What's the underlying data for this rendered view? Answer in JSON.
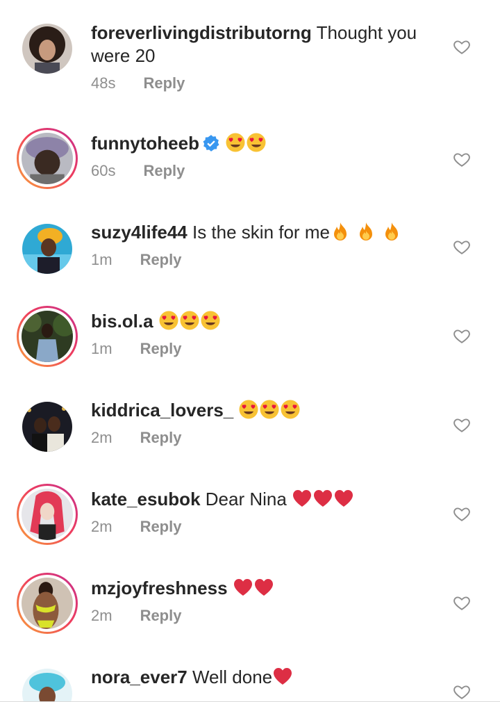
{
  "comments": [
    {
      "username": "foreverlivingdistributorng",
      "text": " Thought you were 20",
      "time": "48s",
      "reply_label": "Reply",
      "verified": false,
      "story_ring": false,
      "emojis": []
    },
    {
      "username": "funnytoheeb",
      "text": "",
      "time": "60s",
      "reply_label": "Reply",
      "verified": true,
      "story_ring": true,
      "emojis": [
        "heart-eyes",
        "heart-eyes"
      ]
    },
    {
      "username": "suzy4life44",
      "text": " Is the skin for me",
      "time": "1m",
      "reply_label": "Reply",
      "verified": false,
      "story_ring": false,
      "emojis": [
        "fire",
        "fire",
        "fire"
      ]
    },
    {
      "username": "bis.ol.a",
      "text": "",
      "time": "1m",
      "reply_label": "Reply",
      "verified": false,
      "story_ring": true,
      "emojis": [
        "heart-eyes",
        "heart-eyes",
        "heart-eyes"
      ]
    },
    {
      "username": "kiddrica_lovers_",
      "text": "",
      "time": "2m",
      "reply_label": "Reply",
      "verified": false,
      "story_ring": false,
      "emojis": [
        "heart-eyes",
        "heart-eyes",
        "heart-eyes"
      ]
    },
    {
      "username": "kate_esubok",
      "text": " Dear Nina",
      "time": "2m",
      "reply_label": "Reply",
      "verified": false,
      "story_ring": true,
      "emojis": [
        "red-heart",
        "red-heart",
        "red-heart"
      ]
    },
    {
      "username": "mzjoyfreshness",
      "text": "",
      "time": "2m",
      "reply_label": "Reply",
      "verified": false,
      "story_ring": true,
      "emojis": [
        "red-heart",
        "red-heart"
      ]
    },
    {
      "username": "nora_ever7",
      "text": " Well done",
      "time": "",
      "reply_label": "",
      "verified": false,
      "story_ring": false,
      "emojis": [
        "red-heart"
      ]
    }
  ],
  "colors": {
    "text": "#262626",
    "secondary": "#8e8e8e",
    "verified": "#3897f0",
    "story_ring_start": "#f9a23a",
    "story_ring_end": "#c62f8f"
  }
}
